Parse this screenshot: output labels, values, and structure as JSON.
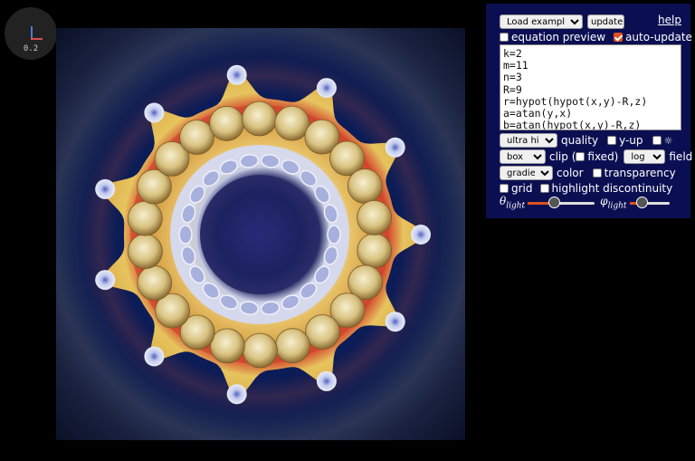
{
  "axis_widget": {
    "zoom_value": "0.2",
    "x_color": "#d84f4f",
    "y_color": "#4f7ad8"
  },
  "panel": {
    "load_example": "Load example...",
    "update_label": "update",
    "help_label": "help",
    "equation_preview_label": "equation preview",
    "equation_preview_checked": false,
    "auto_update_label": "auto-update",
    "auto_update_checked": true,
    "equation_text": "k=2\nm=11\nn=3\nR=9\nr=hypot(hypot(x,y)-R,z)\na=atan(y,x)\nb=atan(hypot(x,y)-R,z)",
    "quality_value": "ultra high",
    "quality_label": "quality",
    "y_up_label": "y-up",
    "light_icon": "☼",
    "clip_value": "box",
    "clip_label": "clip (",
    "fixed_label": "fixed)",
    "field_scale_value": "log",
    "field_label": "field",
    "color_value": "gradient",
    "color_label": "color",
    "transparency_label": "transparency",
    "grid_label": "grid",
    "highlight_label": "highlight discontinuity",
    "theta_symbol": "θ",
    "phi_symbol": "φ",
    "light_subscript": "light",
    "theta_light": 0.37,
    "phi_light": 0.25,
    "accent_color": "#e0501e",
    "panel_bg": "#0b0f52"
  }
}
